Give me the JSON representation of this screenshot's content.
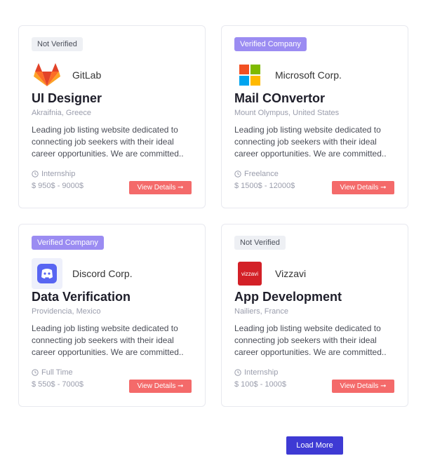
{
  "jobs": [
    {
      "badge": "Not Verified",
      "verified": false,
      "company": "GitLab",
      "logo": "gitlab-icon",
      "title": "UI Designer",
      "location": "Akraifnia, Greece",
      "description": "Leading job listing website dedicated to connecting job seekers with their ideal career opportunities. We are committed..",
      "type": "Internship",
      "salary": "$ 950$ - 9000$",
      "button": "View Details ➞"
    },
    {
      "badge": "Verified Company",
      "verified": true,
      "company": "Microsoft Corp.",
      "logo": "microsoft-icon",
      "title": "Mail COnvertor",
      "location": "Mount Olympus, United States",
      "description": "Leading job listing website dedicated to connecting job seekers with their ideal career opportunities. We are committed..",
      "type": "Freelance",
      "salary": "$ 1500$ - 12000$",
      "button": "View Details ➞"
    },
    {
      "badge": "Verified Company",
      "verified": true,
      "company": "Discord Corp.",
      "logo": "discord-icon",
      "title": "Data Verification",
      "location": "Providencia, Mexico",
      "description": "Leading job listing website dedicated to connecting job seekers with their ideal career opportunities. We are committed..",
      "type": "Full Time",
      "salary": "$ 550$ - 7000$",
      "button": "View Details ➞"
    },
    {
      "badge": "Not Verified",
      "verified": false,
      "company": "Vizzavi",
      "logo": "vizzavi-logo",
      "logo_text": "vizzavi",
      "title": "App Development",
      "location": "Nailiers, France",
      "description": "Leading job listing website dedicated to connecting job seekers with their ideal career opportunities. We are committed..",
      "type": "Internship",
      "salary": "$ 100$ - 1000$",
      "button": "View Details ➞"
    }
  ],
  "load_more": "Load More",
  "colors": {
    "accent_red": "#f46a6a",
    "badge_verified": "#9b8cf2",
    "load_more": "#3e3ad4"
  }
}
